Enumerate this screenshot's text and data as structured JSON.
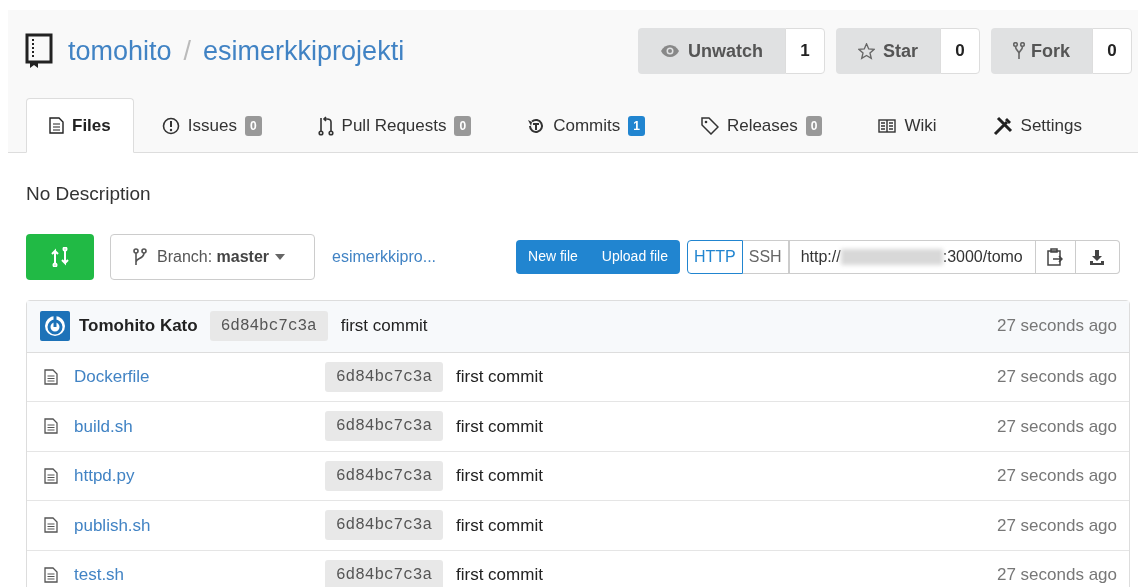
{
  "repo": {
    "owner": "tomohito",
    "separator": "/",
    "name": "esimerkkiprojekti"
  },
  "actions": [
    {
      "kind": "watch",
      "label": "Unwatch",
      "count": "1"
    },
    {
      "kind": "star",
      "label": "Star",
      "count": "0"
    },
    {
      "kind": "fork",
      "label": "Fork",
      "count": "0"
    }
  ],
  "tabs": [
    {
      "kind": "files",
      "label": "Files",
      "selected": true
    },
    {
      "kind": "issues",
      "label": "Issues",
      "count": "0",
      "selected": false
    },
    {
      "kind": "pulls",
      "label": "Pull Requests",
      "count": "0",
      "selected": false
    },
    {
      "kind": "commits",
      "label": "Commits",
      "count": "1",
      "selected": false
    },
    {
      "kind": "releases",
      "label": "Releases",
      "count": "0",
      "selected": false
    },
    {
      "kind": "wiki",
      "label": "Wiki",
      "selected": false
    },
    {
      "kind": "settings",
      "label": "Settings",
      "selected": false
    }
  ],
  "description": "No Description",
  "branch": {
    "label": "Branch:",
    "value": "master"
  },
  "path": "esimerkkipro...",
  "file_buttons": [
    "New file",
    "Upload file"
  ],
  "clone": {
    "protocols": [
      {
        "label": "HTTP",
        "selected": true
      },
      {
        "label": "SSH",
        "selected": false
      }
    ],
    "url_start": "http://",
    "url_end": ":3000/tomo"
  },
  "latest_commit": {
    "author": "Tomohito Kato",
    "sha": "6d84bc7c3a",
    "message": "first commit",
    "time": "27 seconds ago"
  },
  "files": [
    {
      "name": "Dockerfile",
      "sha": "6d84bc7c3a",
      "message": "first commit",
      "time": "27 seconds ago"
    },
    {
      "name": "build.sh",
      "sha": "6d84bc7c3a",
      "message": "first commit",
      "time": "27 seconds ago"
    },
    {
      "name": "httpd.py",
      "sha": "6d84bc7c3a",
      "message": "first commit",
      "time": "27 seconds ago"
    },
    {
      "name": "publish.sh",
      "sha": "6d84bc7c3a",
      "message": "first commit",
      "time": "27 seconds ago"
    },
    {
      "name": "test.sh",
      "sha": "6d84bc7c3a",
      "message": "first commit",
      "time": "27 seconds ago"
    }
  ]
}
